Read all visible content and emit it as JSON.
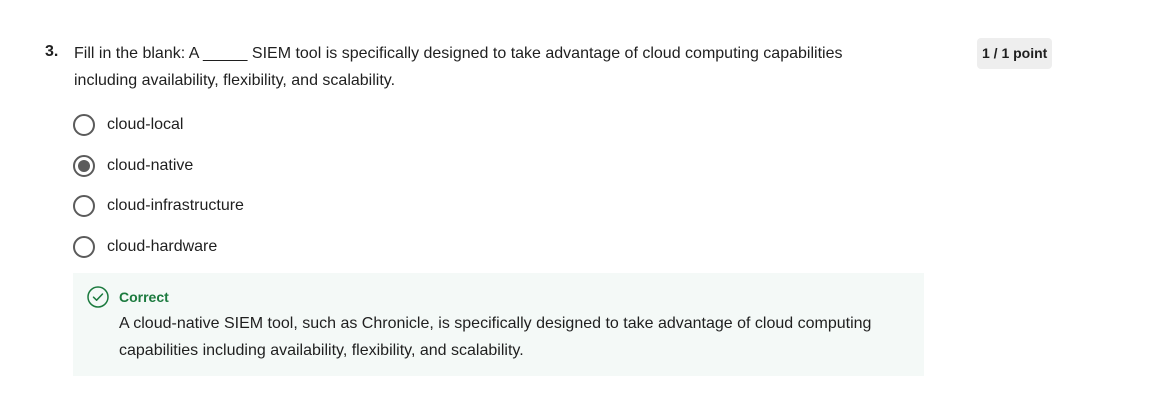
{
  "question": {
    "number": "3.",
    "text": "Fill in the blank: A _____ SIEM tool is specifically designed to take advantage of cloud computing capabilities including availability, flexibility, and scalability.",
    "points": "1 / 1 point"
  },
  "options": [
    {
      "label": "cloud-local",
      "selected": false
    },
    {
      "label": "cloud-native",
      "selected": true
    },
    {
      "label": "cloud-infrastructure",
      "selected": false
    },
    {
      "label": "cloud-hardware",
      "selected": false
    }
  ],
  "feedback": {
    "icon": "check-circle-icon",
    "status": "Correct",
    "explanation": "A cloud-native SIEM tool, such as Chronicle, is specifically designed to take advantage of cloud computing capabilities including availability, flexibility, and scalability.",
    "status_color": "#1b7a3e",
    "background_color": "#f4f9f7"
  }
}
